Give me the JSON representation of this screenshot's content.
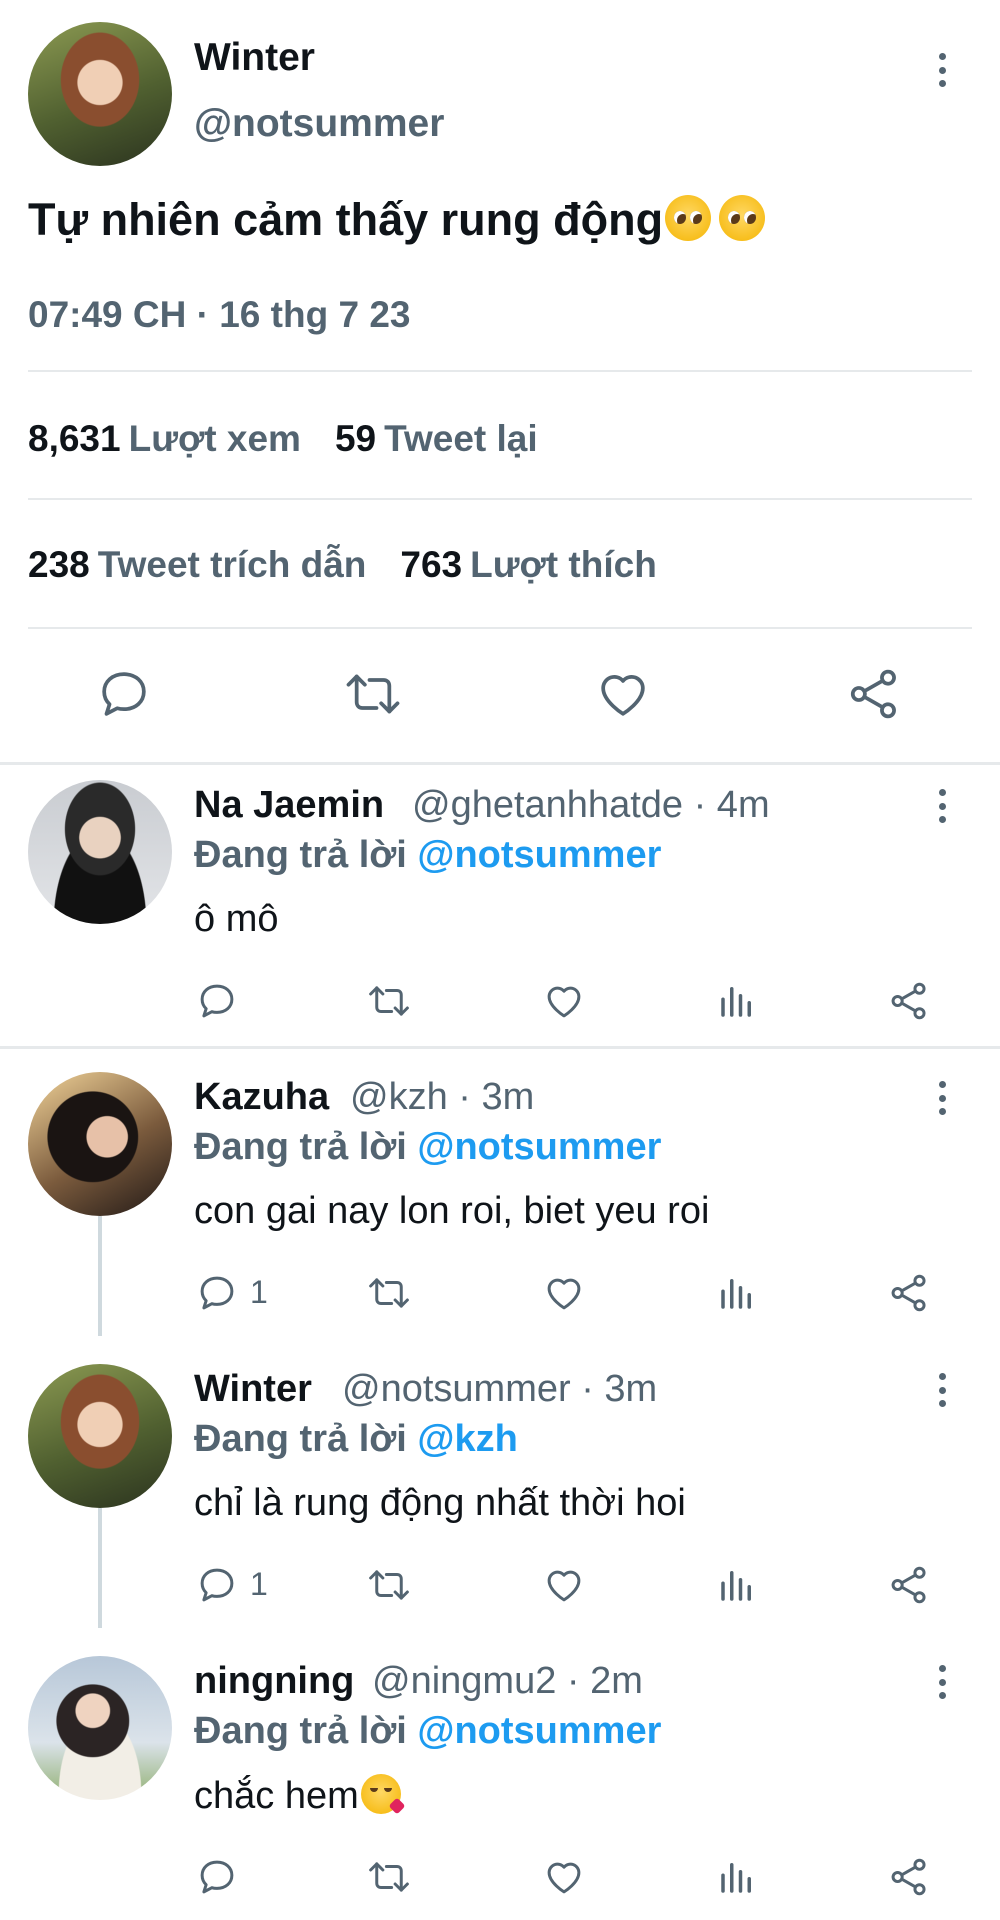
{
  "main_tweet": {
    "author_name": "Winter",
    "author_handle": "@notsummer",
    "text": "Tự nhiên cảm thấy rung động",
    "emoji": [
      "pleading-face",
      "pleading-face"
    ],
    "timestamp": "07:49 CH · 16 thg 7 23",
    "stats": {
      "views_count": "8,631",
      "views_label": "Lượt xem",
      "retweets_count": "59",
      "retweets_label": "Tweet lại",
      "quotes_count": "238",
      "quotes_label": "Tweet trích dẫn",
      "likes_count": "763",
      "likes_label": "Lượt thích"
    },
    "actions": [
      "reply-icon",
      "retweet-icon",
      "like-icon",
      "share-icon"
    ]
  },
  "replies": [
    {
      "name": "Na Jaemin",
      "handle": "@ghetanhhatde",
      "time": "· 4m",
      "reply_prefix": "Đang trả lời",
      "reply_to": "@notsummer",
      "text": "ô mô",
      "reply_count": ""
    },
    {
      "name": "Kazuha",
      "handle": "@kzh",
      "time": "· 3m",
      "reply_prefix": "Đang trả lời",
      "reply_to": "@notsummer",
      "text": "con gai nay lon roi, biet yeu roi",
      "reply_count": "1"
    },
    {
      "name": "Winter",
      "handle": "@notsummer",
      "time": "· 3m",
      "reply_prefix": "Đang trả lời",
      "reply_to": "@kzh",
      "text": "chỉ là rung động nhất thời hoi",
      "reply_count": "1"
    },
    {
      "name": "ningning",
      "handle": "@ningmu2",
      "time": "· 2m",
      "reply_prefix": "Đang trả lời",
      "reply_to": "@notsummer",
      "text": "chắc hem",
      "emoji": "kissing-face-with-heart",
      "reply_count": ""
    }
  ],
  "colors": {
    "text_primary": "#0f1419",
    "text_secondary": "#536471",
    "link": "#1d9bf0",
    "divider": "#e6e9eb"
  }
}
